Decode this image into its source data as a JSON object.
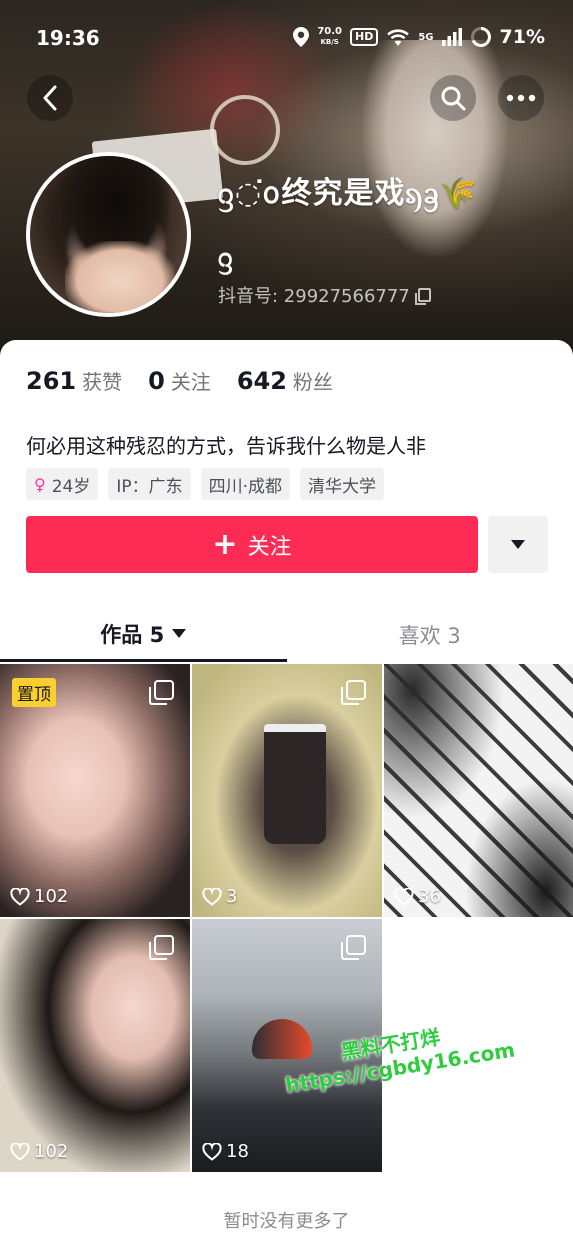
{
  "status_bar": {
    "time": "19:36",
    "net_speed_value": "70.0",
    "net_speed_unit": "KB/S",
    "hd": "HD",
    "signal": "5G",
    "battery": "71%"
  },
  "profile": {
    "nickname": "ᦋ◌͘ᩅ终究是戏ᦣᦃ🌾",
    "nickname_line2": "ᦋ",
    "douyin_id_label": "抖音号: 29927566777",
    "likes_count": "261",
    "likes_label": "获赞",
    "following_count": "0",
    "following_label": "关注",
    "followers_count": "642",
    "followers_label": "粉丝",
    "bio": "何必用这种残忍的方式，告诉我什么物是人非",
    "tags": [
      "24岁",
      "IP：广东",
      "四川·成都",
      "清华大学"
    ]
  },
  "actions": {
    "follow_label": "关注",
    "follow_icon": "+"
  },
  "tabs": [
    {
      "label": "作品 5"
    },
    {
      "label": "喜欢 3"
    }
  ],
  "videos": [
    {
      "likes": "102",
      "pinned_label": "置顶"
    },
    {
      "likes": "3"
    },
    {
      "likes": "36"
    },
    {
      "likes": "102"
    },
    {
      "likes": "18"
    }
  ],
  "watermark": {
    "line1": "黑料不打烊",
    "line2": "https://cgbdy16.com"
  },
  "footer": "暂时没有更多了",
  "colors": {
    "accent": "#fe2c55",
    "pin_badge": "#facf2f",
    "watermark": "#2ecc3f"
  }
}
